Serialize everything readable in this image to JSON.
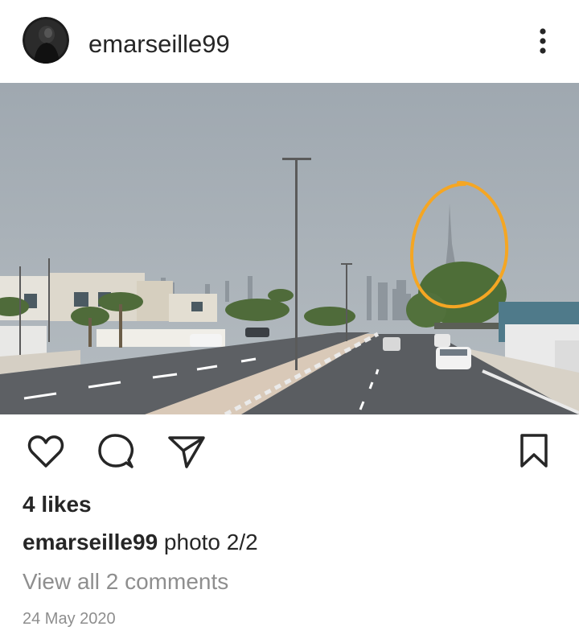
{
  "post": {
    "username": "emarseille99",
    "likes": "4 likes",
    "caption_user": "emarseille99",
    "caption_text": "photo 2/2",
    "comments_link": "View all 2 comments",
    "date": "24 May 2020"
  },
  "icons": {
    "more": "more-options-icon",
    "like": "heart-icon",
    "comment": "comment-bubble-icon",
    "share": "paper-plane-icon",
    "save": "bookmark-icon"
  },
  "colors": {
    "text": "#262626",
    "secondary": "#8e8e8e",
    "annotation_circle": "#f5a623"
  }
}
